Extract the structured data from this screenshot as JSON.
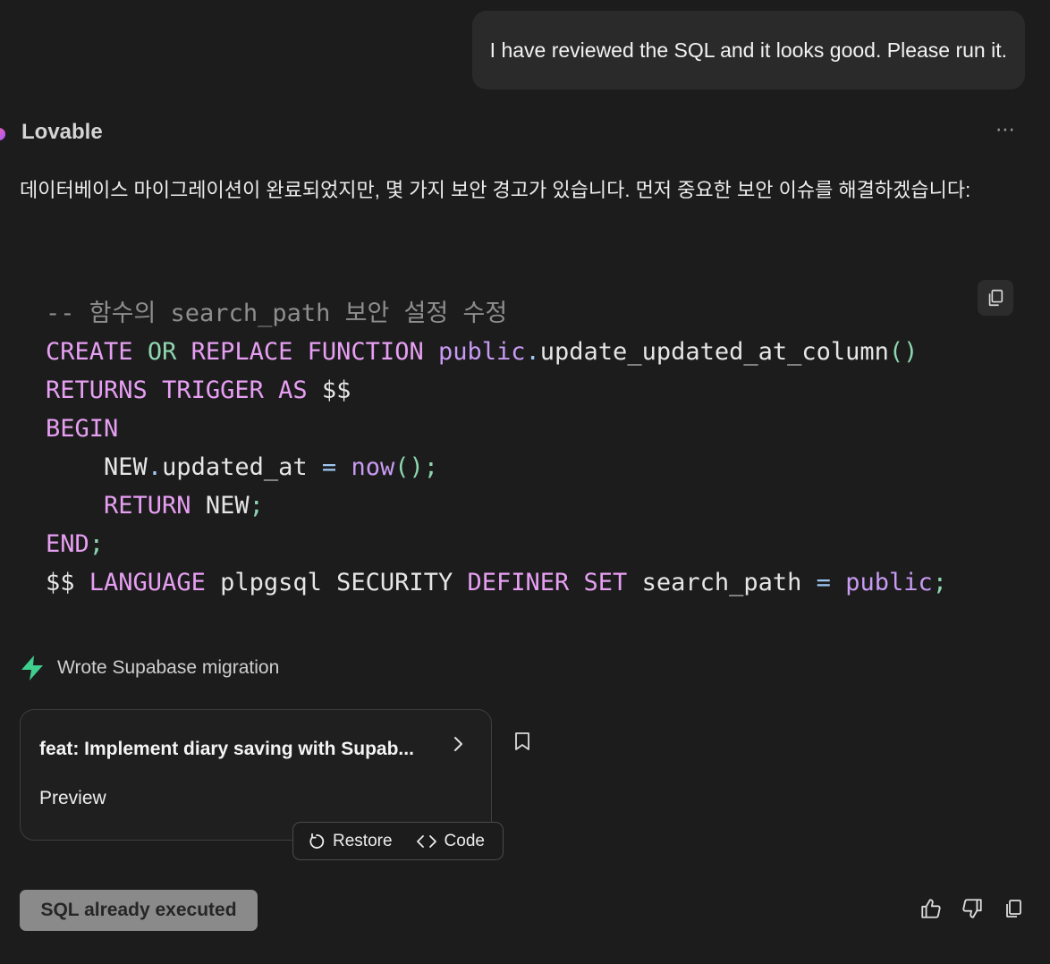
{
  "user_message": {
    "text": "I have reviewed the SQL and it looks good. Please run it."
  },
  "assistant": {
    "name": "Lovable",
    "more_label": "⋯",
    "message": "데이터베이스 마이그레이션이 완료되었지만, 몇 가지 보안 경고가 있습니다. 먼저 중요한 보안 이슈를 해결하겠습니다:"
  },
  "code": {
    "language": "sql",
    "tokens": {
      "comment": "-- 함수의 search_path 보안 설정 수정",
      "create": "CREATE",
      "or": "OR",
      "replace": "REPLACE",
      "function": "FUNCTION",
      "schema": "public",
      "dot": ".",
      "func_name": "update_updated_at_column",
      "parens": "()",
      "returns": "RETURNS",
      "trigger": "TRIGGER",
      "as": "AS",
      "dollars": "$$",
      "begin": "BEGIN",
      "indent": "    ",
      "new": "NEW",
      "updated_at": "updated_at",
      "eq": "=",
      "now": "now",
      "call": "()",
      "semi": ";",
      "return": "RETURN",
      "end": "END",
      "language": "LANGUAGE",
      "plpgsql": "plpgsql",
      "security": "SECURITY",
      "definer": "DEFINER",
      "set": "SET",
      "search_path": "search_path",
      "sp": " "
    }
  },
  "tool_call": {
    "icon": "bolt-icon",
    "label": "Wrote Supabase migration"
  },
  "commit_card": {
    "title": "feat: Implement diary saving with Supab...",
    "preview_label": "Preview",
    "restore_label": "Restore",
    "code_label": "Code"
  },
  "sql_button": {
    "label": "SQL already executed"
  },
  "feedback": {
    "icons": [
      "thumbs-up-icon",
      "thumbs-down-icon",
      "copy-icon"
    ]
  },
  "colors": {
    "background": "#1c1c1c",
    "bubble": "#2a2a2a",
    "keyword": "#e79ff3",
    "function": "#c89bf4",
    "punctuation": "#8ed6b0",
    "operator": "#9fc7f2",
    "comment": "#8e8e8e",
    "bolt": "#3ecf8e",
    "disabled_button": "#8a8a8a"
  }
}
